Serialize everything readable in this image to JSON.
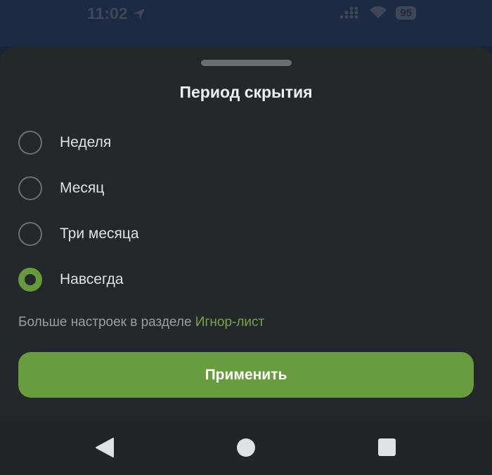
{
  "status_bar": {
    "time": "11:02",
    "battery": "95",
    "icons": [
      "location-arrow-icon",
      "signal-icon",
      "wifi-icon",
      "battery-icon"
    ]
  },
  "sheet": {
    "title": "Период скрытия",
    "options": [
      {
        "label": "Неделя",
        "checked": false
      },
      {
        "label": "Месяц",
        "checked": false
      },
      {
        "label": "Три месяца",
        "checked": false
      },
      {
        "label": "Навсегда",
        "checked": true
      }
    ],
    "hint_prefix": "Больше настроек в разделе ",
    "hint_link": "Игнор-лист",
    "apply_label": "Применить"
  },
  "colors": {
    "accent": "#689c3f",
    "link": "#72a54a",
    "sheet_bg": "#25282b"
  },
  "nav_bar": {
    "icons": [
      "back-icon",
      "home-icon",
      "recent-apps-icon"
    ]
  }
}
